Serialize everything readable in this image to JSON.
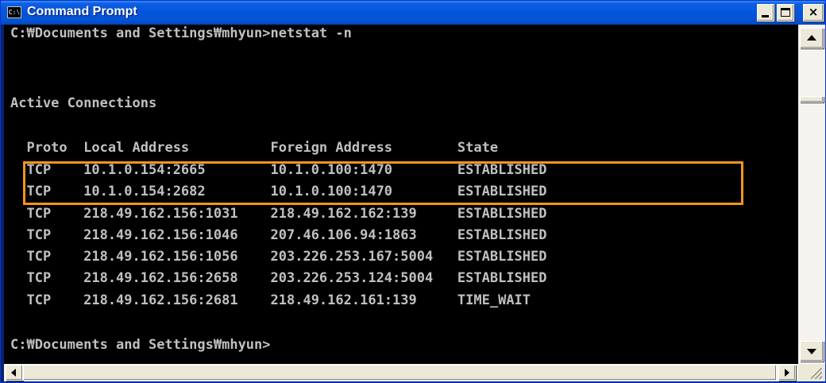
{
  "window": {
    "title": "Command Prompt",
    "icon_label": "C:\\"
  },
  "console": {
    "lines": [
      "C:₩Documents and Settings₩mhyun>netstat -n",
      "",
      "Active Connections",
      "",
      "  Proto  Local Address          Foreign Address        State",
      "  TCP    10.1.0.154:2665        10.1.0.100:1470        ESTABLISHED",
      "  TCP    10.1.0.154:2682        10.1.0.100:1470        ESTABLISHED",
      "  TCP    218.49.162.156:1031    218.49.162.162:139     ESTABLISHED",
      "  TCP    218.49.162.156:1046    207.46.106.94:1863     ESTABLISHED",
      "  TCP    218.49.162.156:1056    203.226.253.167:5004   ESTABLISHED",
      "  TCP    218.49.162.156:2658    203.226.253.124:5004   ESTABLISHED",
      "  TCP    218.49.162.156:2681    218.49.162.161:139     TIME_WAIT",
      "",
      "C:₩Documents and Settings₩mhyun>"
    ]
  },
  "colors": {
    "console_bg": "#000000",
    "console_text": "#c0c0c0",
    "highlight": "#f7941d",
    "titlebar": "#0553d9"
  },
  "icons": {
    "app": "console-icon",
    "minimize": "minimize-icon",
    "maximize": "maximize-icon",
    "close": "close-icon"
  }
}
